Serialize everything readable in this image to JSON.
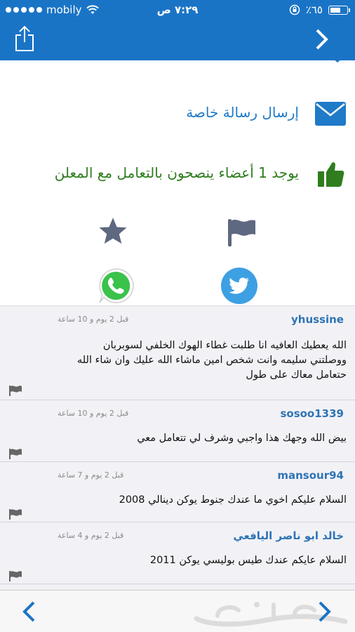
{
  "status_bar": {
    "carrier": "mobily",
    "time": "٧:٢٩ ص",
    "battery": "٪٦٥",
    "battery_level": 0.65
  },
  "actions": {
    "send_private_message": "إرسال رسالة خاصة",
    "recommendation": "يوجد 1 أعضاء ينصحون بالتعامل مع المعلن"
  },
  "comments": [
    {
      "user": "yhussine",
      "time": "قبل 2 يوم و 10 ساعة",
      "lines": [
        "الله يعطيك العافيه انا طلبت غطاء الهوك الخلفي لسوبربان",
        "ووصلتني سليمه وانت شخص امين ماشاء الله عليك وان شاء الله",
        "حتعامل معاك على طول"
      ]
    },
    {
      "user": "sosoo1339",
      "time": "قبل 2 يوم و 10 ساعة",
      "lines": [
        "بيض الله وجهك هذا واجبي وشرف لي تتعامل معي"
      ]
    },
    {
      "user": "mansour94",
      "time": "قبل 2 يوم و 7 ساعة",
      "lines": [
        "السلام عليكم اخوي ما عندك جنوط يوكن دينالي 2008"
      ]
    },
    {
      "user": "خالد ابو ناصر اليافعي",
      "time": "قبل 2 يوم و 4 ساعة",
      "lines": [
        "السلام عايكم عندك طيس بوليسي يوكن 2011"
      ]
    }
  ],
  "colors": {
    "nav_blue": "#1a74c6",
    "link_blue": "#1f7ac8",
    "recommend_green": "#2f7d1e",
    "icon_gray": "#5e6880"
  },
  "icons": {
    "share": "share-icon",
    "forward": "chevron-right-icon",
    "message": "envelope-icon",
    "thumbs_up": "thumbs-up-icon",
    "favorite": "star-icon",
    "report": "flag-icon",
    "whatsapp": "whatsapp-icon",
    "twitter": "twitter-icon",
    "back": "chevron-left-icon"
  },
  "watermark": "حراج"
}
